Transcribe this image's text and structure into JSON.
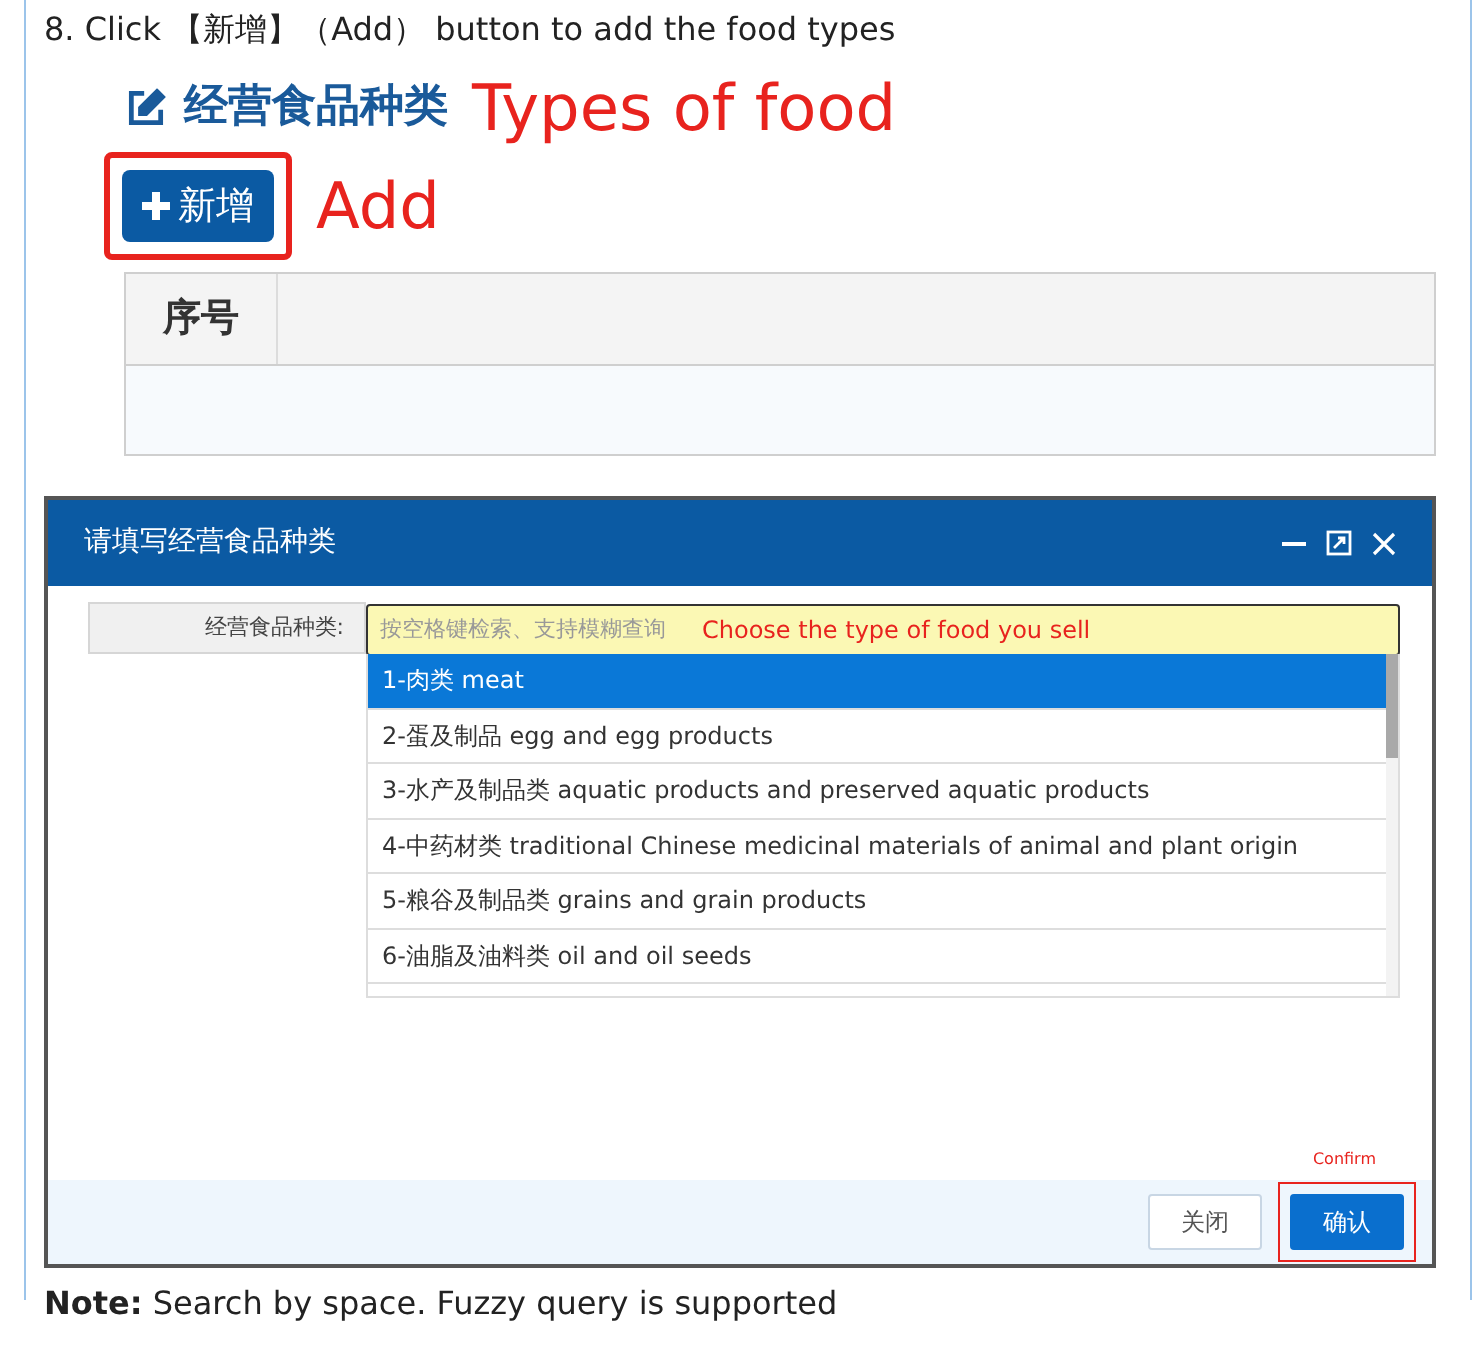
{
  "step": "8. Click 【新增】（Add） button to add the food types",
  "section": {
    "title": "经营食品种类",
    "annotation": "Types of food",
    "add_button": "新增",
    "add_annotation": "Add",
    "table": {
      "columns": [
        "序号"
      ]
    }
  },
  "dialog": {
    "title": "请填写经营食品种类",
    "field": {
      "label": "经营食品种类:",
      "placeholder": "按空格键检索、支持模糊查询",
      "annotation": "Choose the type of food you sell"
    },
    "options": [
      {
        "label": "1-肉类 meat",
        "selected": true
      },
      {
        "label": "2-蛋及制品 egg and egg products",
        "selected": false
      },
      {
        "label": "3-水产及制品类 aquatic products and preserved aquatic products",
        "selected": false
      },
      {
        "label": "4-中药材类 traditional Chinese medicinal materials of animal and plant origin",
        "selected": false
      },
      {
        "label": "5-粮谷及制品类 grains and grain products",
        "selected": false
      },
      {
        "label": "6-油脂及油料类 oil and oil seeds",
        "selected": false
      }
    ],
    "confirm_annotation": "Confirm",
    "buttons": [
      {
        "label": "关闭",
        "kind": "secondary"
      },
      {
        "label": "确认",
        "kind": "primary"
      }
    ]
  },
  "note": "**Note:** Search by space. Fuzzy query is supported"
}
